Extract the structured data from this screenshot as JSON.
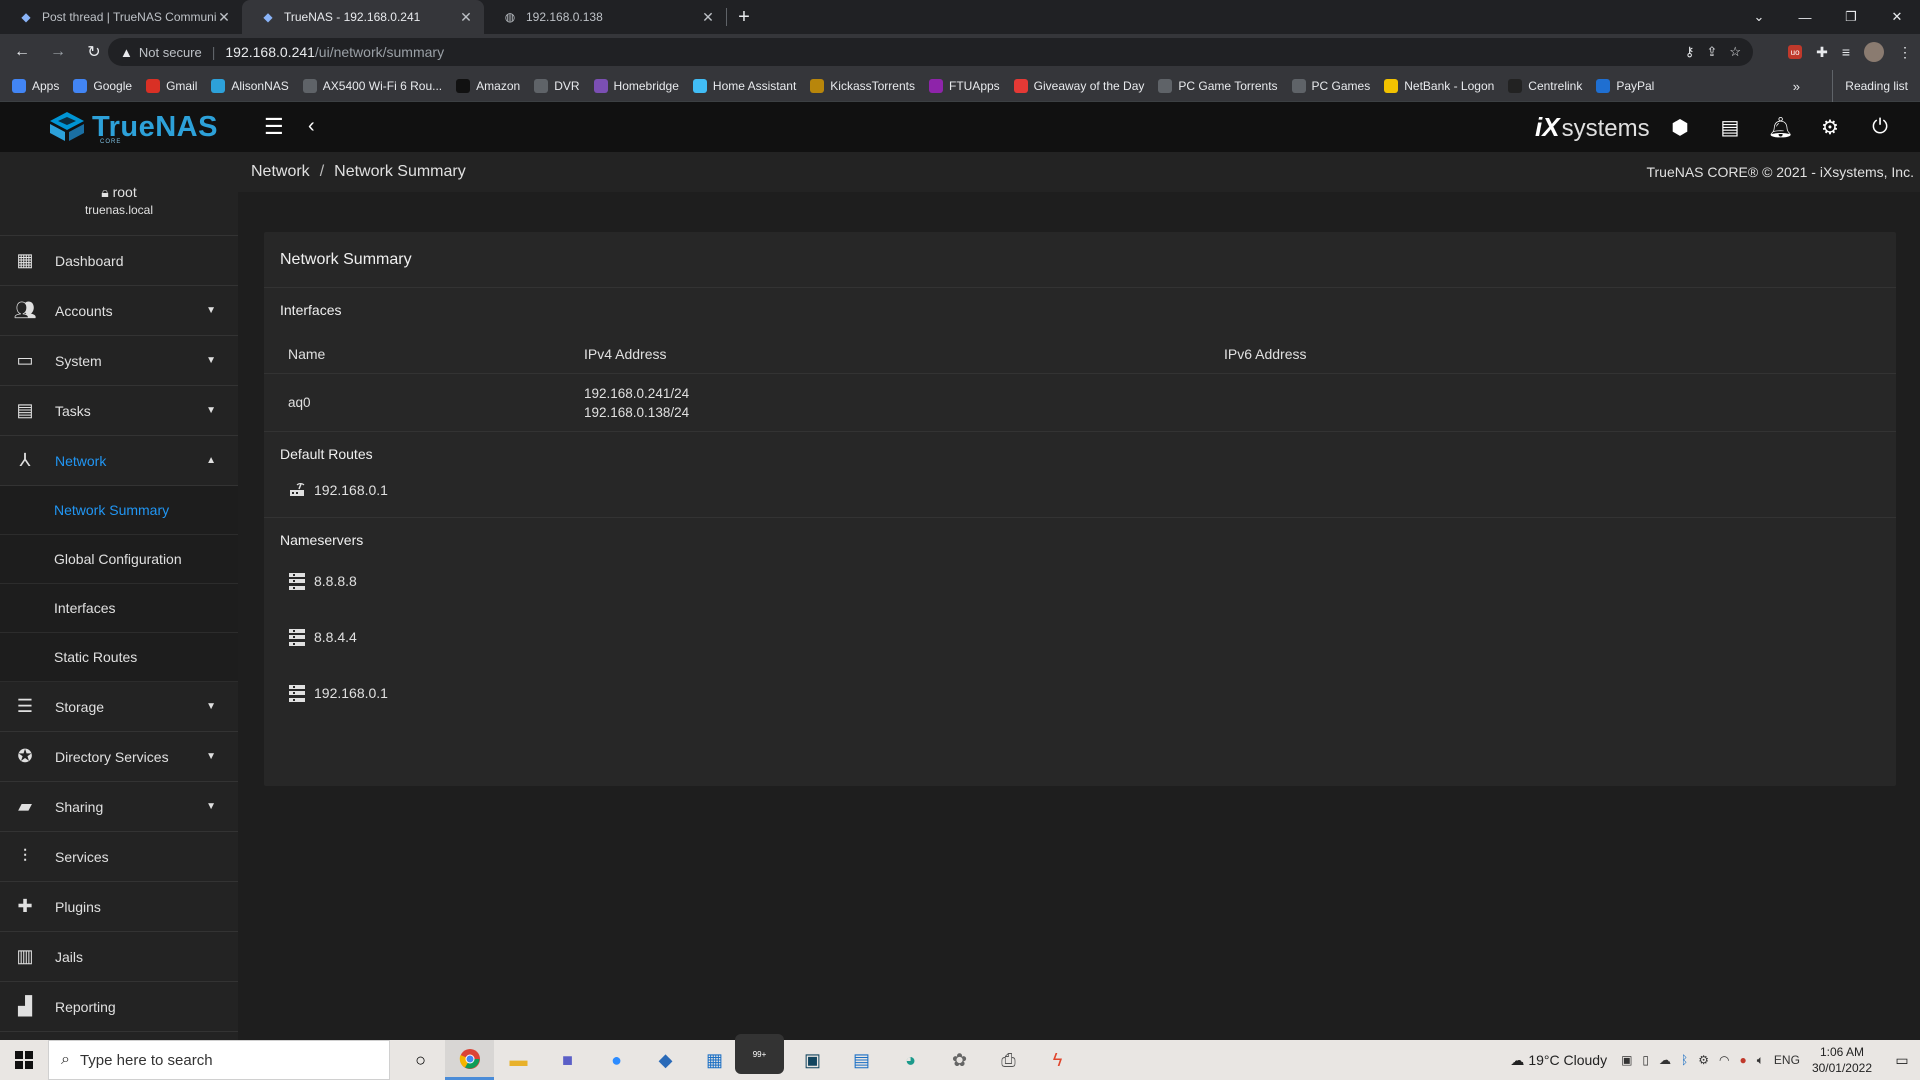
{
  "browser": {
    "tabs": [
      {
        "title": "Post thread | TrueNAS Communit",
        "active": false
      },
      {
        "title": "TrueNAS - 192.168.0.241",
        "active": true
      },
      {
        "title": "192.168.0.138",
        "active": false
      }
    ],
    "address": {
      "security_label": "Not secure",
      "host": "192.168.0.241",
      "path": "/ui/network/summary"
    },
    "bookmarks": [
      {
        "label": "Apps",
        "color": "#4285f4"
      },
      {
        "label": "Google",
        "color": "#4285f4"
      },
      {
        "label": "Gmail",
        "color": "#d93025"
      },
      {
        "label": "AlisonNAS",
        "color": "#2da1d9"
      },
      {
        "label": "AX5400 Wi-Fi 6 Rou...",
        "color": "#5f6368"
      },
      {
        "label": "Amazon",
        "color": "#111111"
      },
      {
        "label": "DVR",
        "color": "#5f6368"
      },
      {
        "label": "Homebridge",
        "color": "#7b4fb3"
      },
      {
        "label": "Home Assistant",
        "color": "#41bdf5"
      },
      {
        "label": "KickassTorrents",
        "color": "#b8860b"
      },
      {
        "label": "FTUApps",
        "color": "#8e24aa"
      },
      {
        "label": "Giveaway of the Day",
        "color": "#e53935"
      },
      {
        "label": "PC Game Torrents",
        "color": "#5f6368"
      },
      {
        "label": "PC Games",
        "color": "#5f6368"
      },
      {
        "label": "NetBank - Logon",
        "color": "#f2c200"
      },
      {
        "label": "Centrelink",
        "color": "#222222"
      },
      {
        "label": "PayPal",
        "color": "#1f6fd1"
      }
    ],
    "more": "»",
    "reading_list": "Reading list"
  },
  "app": {
    "logo": "TrueNAS",
    "logo_sub": "CORE",
    "vendor": {
      "ix": "iX",
      "systems": "systems"
    },
    "user": {
      "name": "root",
      "host": "truenas.local"
    },
    "nav": [
      {
        "label": "Dashboard",
        "icon": "dashboard-icon",
        "caret": ""
      },
      {
        "label": "Accounts",
        "icon": "people-icon",
        "caret": "▼"
      },
      {
        "label": "System",
        "icon": "laptop-icon",
        "caret": "▼"
      },
      {
        "label": "Tasks",
        "icon": "calendar-icon",
        "caret": "▼"
      },
      {
        "label": "Network",
        "icon": "network-icon",
        "caret": "▲"
      }
    ],
    "network_sub": [
      "Network Summary",
      "Global Configuration",
      "Interfaces",
      "Static Routes"
    ],
    "nav_after": [
      {
        "label": "Storage",
        "icon": "storage-icon",
        "caret": "▼"
      },
      {
        "label": "Directory Services",
        "icon": "directory-icon",
        "caret": "▼"
      },
      {
        "label": "Sharing",
        "icon": "folder-shared-icon",
        "caret": "▼"
      },
      {
        "label": "Services",
        "icon": "tune-icon",
        "caret": ""
      },
      {
        "label": "Plugins",
        "icon": "puzzle-icon",
        "caret": ""
      },
      {
        "label": "Jails",
        "icon": "jail-icon",
        "caret": ""
      },
      {
        "label": "Reporting",
        "icon": "chart-icon",
        "caret": ""
      }
    ],
    "breadcrumb": {
      "parent": "Network",
      "sep": "/",
      "current": "Network Summary"
    },
    "copyright": "TrueNAS CORE® © 2021 - iXsystems, Inc.",
    "accent": "#2196f3",
    "card": {
      "title": "Network Summary",
      "interfaces_heading": "Interfaces",
      "columns": [
        "Name",
        "IPv4 Address",
        "IPv6 Address"
      ],
      "rows": [
        {
          "name": "aq0",
          "ipv4": [
            "192.168.0.241/24",
            "192.168.0.138/24"
          ],
          "ipv6": ""
        }
      ],
      "routes_heading": "Default Routes",
      "routes": [
        "192.168.0.1"
      ],
      "nameservers_heading": "Nameservers",
      "nameservers": [
        "8.8.8.8",
        "8.8.4.4",
        "192.168.0.1"
      ]
    }
  },
  "taskbar": {
    "search_placeholder": "Type here to search",
    "weather": "19°C  Cloudy",
    "lang": "ENG",
    "time": "1:06 AM",
    "date": "30/01/2022",
    "mail_badge": "99+"
  }
}
